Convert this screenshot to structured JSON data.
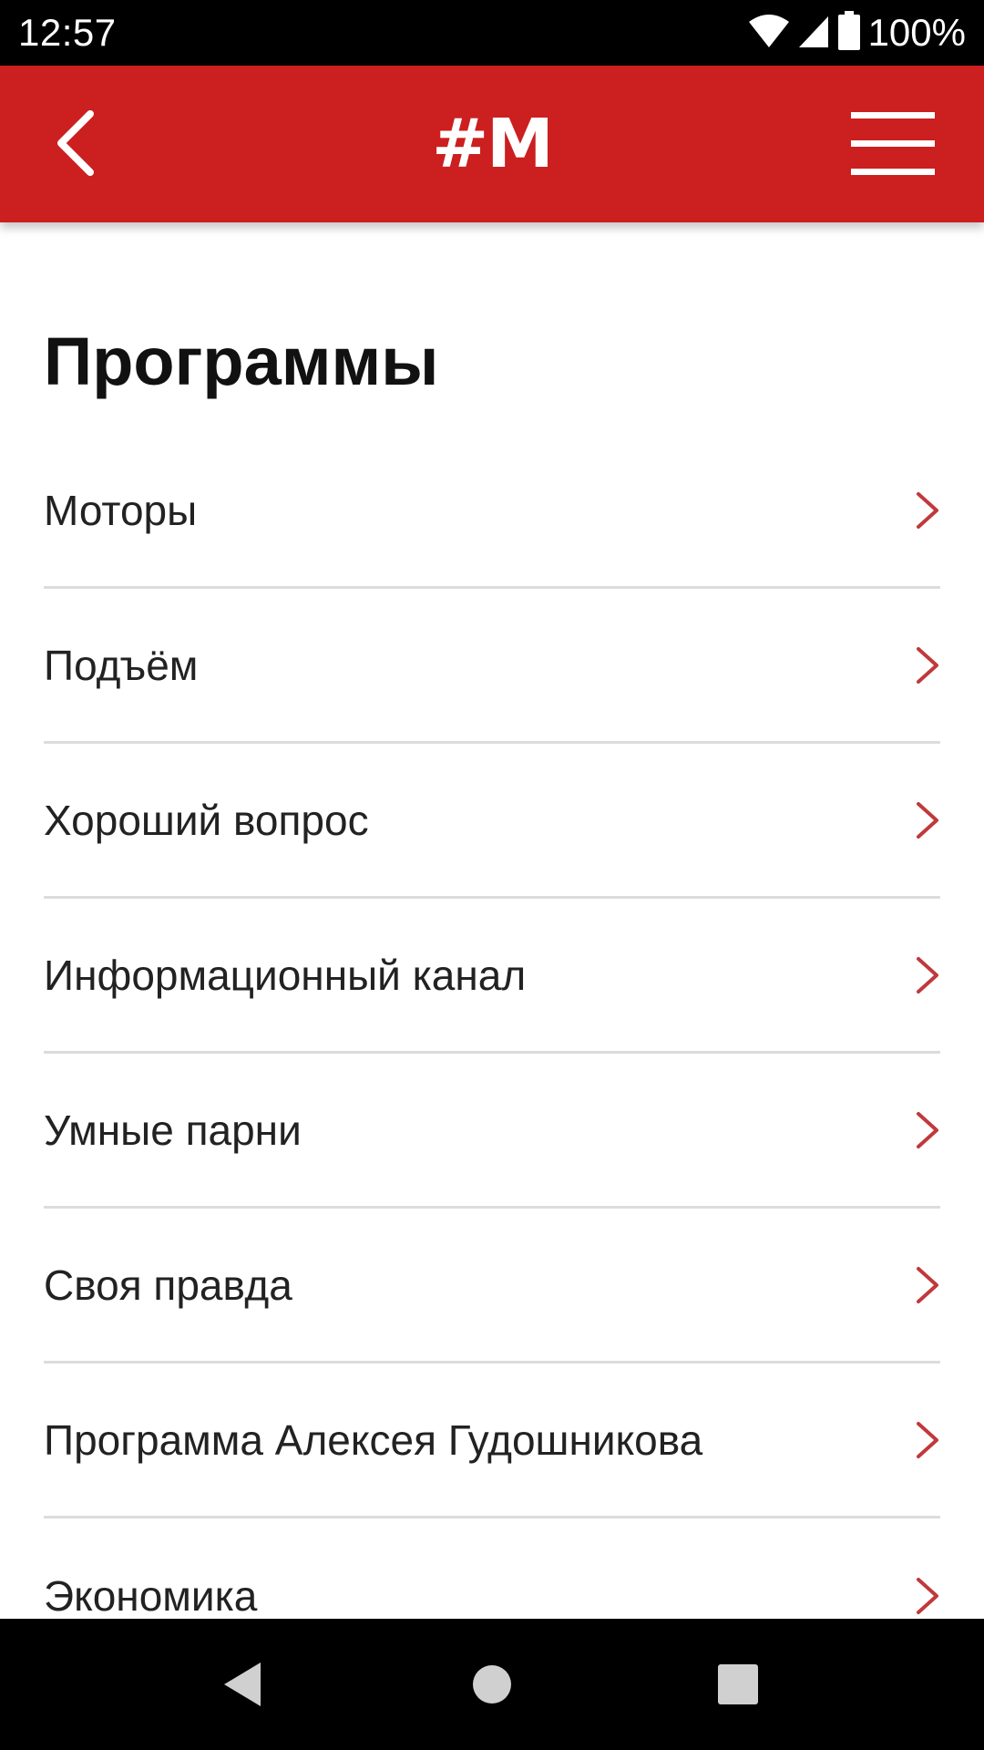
{
  "status_bar": {
    "time": "12:57",
    "battery": "100%",
    "icons": [
      "wifi-icon",
      "signal-icon",
      "battery-icon"
    ]
  },
  "app_bar": {
    "logo": "#M",
    "color": "#CC1F1F",
    "back_icon": "back-arrow-icon",
    "menu_icon": "hamburger-menu-icon"
  },
  "page": {
    "title": "Программы"
  },
  "programs": [
    {
      "label": "Моторы"
    },
    {
      "label": "Подъём"
    },
    {
      "label": "Хороший вопрос"
    },
    {
      "label": "Информационный канал"
    },
    {
      "label": "Умные парни"
    },
    {
      "label": "Своя правда"
    },
    {
      "label": "Программа Алексея Гудошникова"
    },
    {
      "label": "Экономика"
    }
  ],
  "chevron_color": "#C0393B",
  "nav_bar": {
    "buttons": [
      "back-triangle-icon",
      "home-circle-icon",
      "recents-square-icon"
    ]
  }
}
